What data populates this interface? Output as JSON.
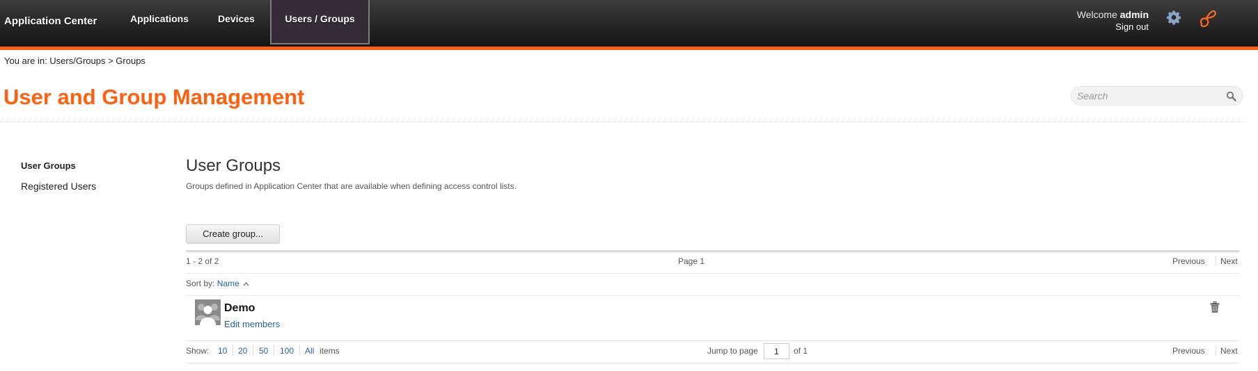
{
  "header": {
    "brand": "Application Center",
    "nav": [
      {
        "label": "Applications",
        "active": false
      },
      {
        "label": "Devices",
        "active": false
      },
      {
        "label": "Users / Groups",
        "active": true
      }
    ],
    "welcome_prefix": "Welcome",
    "username": "admin",
    "sign_out": "Sign out",
    "icons": {
      "settings": "gear-icon",
      "logo": "infinity-logo-icon"
    },
    "accent_color": "#ff6010"
  },
  "breadcrumb": "You are in: Users/Groups > Groups",
  "page": {
    "title": "User and Group Management",
    "search_placeholder": "Search"
  },
  "sidebar": {
    "items": [
      {
        "label": "User Groups",
        "active": true
      },
      {
        "label": "Registered Users",
        "active": false
      }
    ]
  },
  "main": {
    "section_title": "User Groups",
    "section_description": "Groups defined in Application Center that are available when defining access control lists.",
    "create_button": "Create group...",
    "range_text": "1 - 2 of 2",
    "page_text": "Page 1",
    "previous": "Previous",
    "next": "Next",
    "sort_label": "Sort by:",
    "sort_field": "Name",
    "sort_direction": "ascending",
    "groups": [
      {
        "name": "Demo",
        "action": "Edit members"
      }
    ],
    "show_label": "Show:",
    "show_options": [
      "10",
      "20",
      "50",
      "100",
      "All"
    ],
    "show_suffix": "items",
    "jump_label": "Jump to page",
    "jump_value": "1",
    "jump_of": "of 1"
  }
}
